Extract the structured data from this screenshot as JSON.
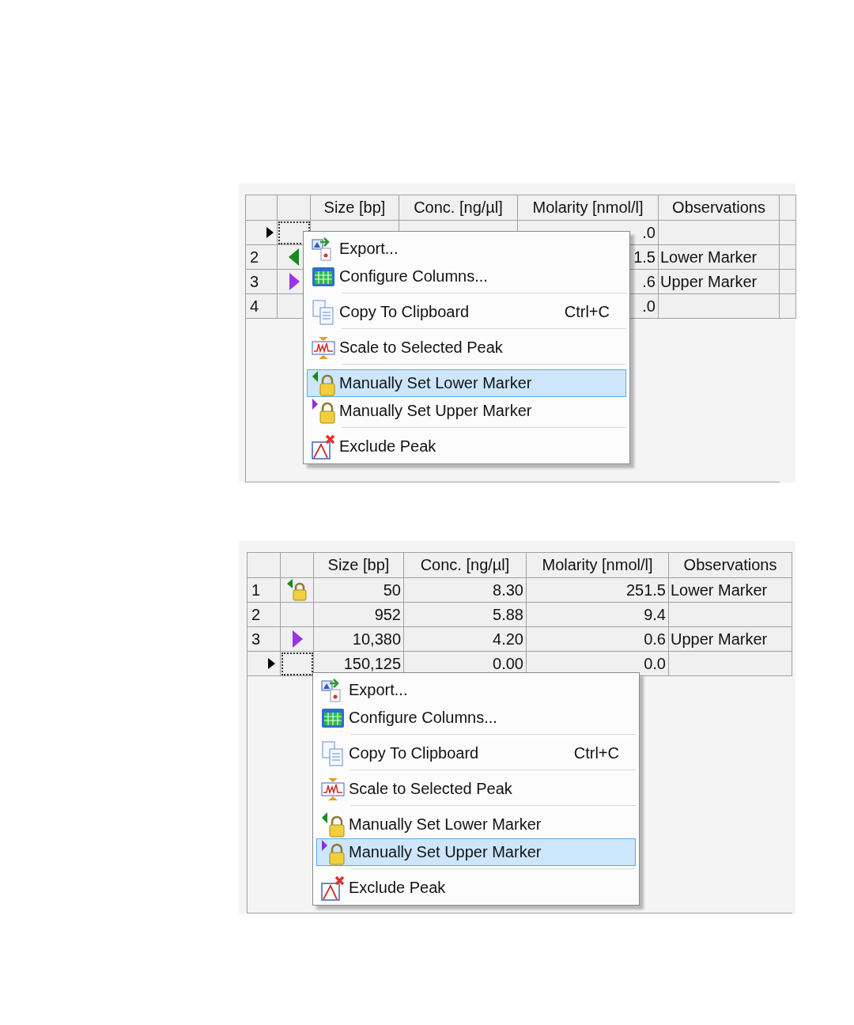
{
  "panels": [
    {
      "columns": [
        "Size [bp]",
        "Conc. [ng/µl]",
        "Molarity [nmol/l]",
        "Observations"
      ],
      "rows": [
        {
          "current": true,
          "kind": "plain",
          "molarity": ".0"
        },
        {
          "current": false,
          "number": "2",
          "kind": "lower",
          "molarity": "1.5",
          "observations": "Lower Marker"
        },
        {
          "current": false,
          "number": "3",
          "kind": "upper",
          "molarity": ".6",
          "observations": "Upper Marker"
        },
        {
          "current": false,
          "number": "4",
          "kind": "plain",
          "molarity": ".0"
        }
      ],
      "menu": [
        {
          "label": "Export...",
          "selected": false,
          "separator_after": false
        },
        {
          "label": "Configure Columns...",
          "selected": false,
          "separator_after": true
        },
        {
          "label": "Copy To Clipboard",
          "shortcut": "Ctrl+C",
          "selected": false,
          "separator_after": true
        },
        {
          "label": "Scale to Selected Peak",
          "selected": false,
          "separator_after": true
        },
        {
          "label": "Manually Set Lower Marker",
          "selected": true,
          "separator_after": false
        },
        {
          "label": "Manually Set Upper Marker",
          "selected": false,
          "separator_after": true
        },
        {
          "label": "Exclude Peak",
          "selected": false,
          "separator_after": false
        }
      ]
    },
    {
      "columns": [
        "Size [bp]",
        "Conc. [ng/µl]",
        "Molarity [nmol/l]",
        "Observations"
      ],
      "rows": [
        {
          "current": false,
          "number": "1",
          "kind": "locked",
          "size": "50",
          "conc": "8.30",
          "molarity": "251.5",
          "observations": "Lower Marker"
        },
        {
          "current": false,
          "number": "2",
          "kind": "plain",
          "size": "952",
          "conc": "5.88",
          "molarity": "9.4"
        },
        {
          "current": false,
          "number": "3",
          "kind": "upper",
          "size": "10,380",
          "conc": "4.20",
          "molarity": "0.6",
          "observations": "Upper Marker"
        },
        {
          "current": true,
          "kind": "plain",
          "size": "150,125",
          "conc": "0.00",
          "molarity": "0.0"
        }
      ],
      "menu": [
        {
          "label": "Export...",
          "selected": false,
          "separator_after": false
        },
        {
          "label": "Configure Columns...",
          "selected": false,
          "separator_after": true
        },
        {
          "label": "Copy To Clipboard",
          "shortcut": "Ctrl+C",
          "selected": false,
          "separator_after": true
        },
        {
          "label": "Scale to Selected Peak",
          "selected": false,
          "separator_after": true
        },
        {
          "label": "Manually Set Lower Marker",
          "selected": false,
          "separator_after": false
        },
        {
          "label": "Manually Set Upper Marker",
          "selected": true,
          "separator_after": true
        },
        {
          "label": "Exclude Peak",
          "selected": false,
          "separator_after": false
        }
      ]
    }
  ]
}
